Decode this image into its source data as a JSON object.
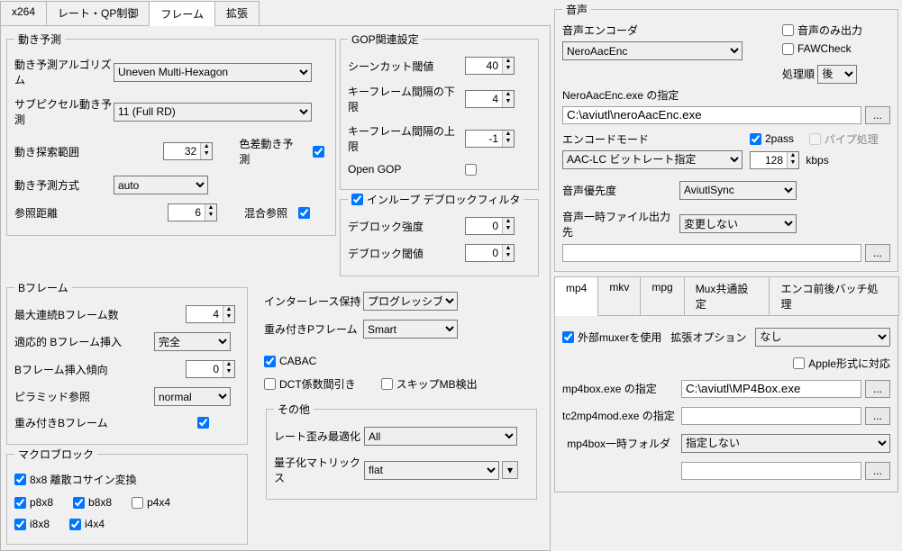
{
  "tabs": [
    "x264",
    "レート・QP制御",
    "フレーム",
    "拡張"
  ],
  "active_tab": "フレーム",
  "motion": {
    "legend": "動き予測",
    "algo_label": "動き予測アルゴリズム",
    "algo_value": "Uneven Multi-Hexagon",
    "subpixel_label": "サブピクセル動き予測",
    "subpixel_value": "11 (Full RD)",
    "range_label": "動き探索範囲",
    "range_value": "32",
    "chroma_label": "色差動き予測",
    "chroma_checked": true,
    "method_label": "動き予測方式",
    "method_value": "auto",
    "refdist_label": "参照距離",
    "refdist_value": "6",
    "mixed_label": "混合参照",
    "mixed_checked": true
  },
  "bframe": {
    "legend": "Bフレーム",
    "max_label": "最大連続Bフレーム数",
    "max_value": "4",
    "adaptive_label": "適応的 Bフレーム挿入",
    "adaptive_value": "完全",
    "bias_label": "Bフレーム挿入傾向",
    "bias_value": "0",
    "pyramid_label": "ピラミッド参照",
    "pyramid_value": "normal",
    "weightb_label": "重み付きBフレーム",
    "weightb_checked": true
  },
  "mb": {
    "legend": "マクロブロック",
    "dct8_label": "8x8 離散コサイン変換",
    "p8x8": "p8x8",
    "b8x8": "b8x8",
    "p4x4": "p4x4",
    "i8x8": "i8x8",
    "i4x4": "i4x4"
  },
  "gop": {
    "legend": "GOP関連設定",
    "scenecut_label": "シーンカット閾値",
    "scenecut_value": "40",
    "minkey_label": "キーフレーム間隔の下限",
    "minkey_value": "4",
    "maxkey_label": "キーフレーム間隔の上限",
    "maxkey_value": "-1",
    "opengop_label": "Open GOP"
  },
  "deblock": {
    "enable_label": "インループ デブロックフィルタ",
    "enable_checked": true,
    "strength_label": "デブロック強度",
    "strength_value": "0",
    "thresh_label": "デブロック閾値",
    "thresh_value": "0"
  },
  "mid": {
    "interlace_label": "インターレース保持",
    "interlace_value": "プログレッシブ",
    "weightp_label": "重み付きPフレーム",
    "weightp_value": "Smart",
    "cabac_label": "CABAC",
    "cabac_checked": true,
    "dct_decimate_label": "DCT係数間引き",
    "skip_mb_label": "スキップMB検出"
  },
  "other": {
    "legend": "その他",
    "trellis_label": "レート歪み最適化",
    "trellis_value": "All",
    "cqm_label": "量子化マトリックス",
    "cqm_value": "flat"
  },
  "audio": {
    "legend": "音声",
    "encoder_label": "音声エンコーダ",
    "encoder_value": "NeroAacEnc",
    "audio_only_label": "音声のみ出力",
    "fawcheck_label": "FAWCheck",
    "proc_order_label": "処理順",
    "proc_order_value": "後",
    "exe_label": "NeroAacEnc.exe の指定",
    "exe_path": "C:\\aviutl\\neroAacEnc.exe",
    "mode_label": "エンコードモード",
    "mode_value": "AAC-LC ビットレート指定",
    "twopass_label": "2pass",
    "pipe_label": "パイプ処理",
    "bitrate_value": "128",
    "bitrate_unit": "kbps",
    "priority_label": "音声優先度",
    "priority_value": "AviutlSync",
    "tmp_label": "音声一時ファイル出力先",
    "tmp_value": "変更しない"
  },
  "mux": {
    "tabs": [
      "mp4",
      "mkv",
      "mpg",
      "Mux共通設定",
      "エンコ前後バッチ処理"
    ],
    "active": "mp4",
    "ext_muxer_label": "外部muxerを使用",
    "ext_muxer_checked": true,
    "ext_opt_label": "拡張オプション",
    "ext_opt_value": "なし",
    "apple_label": "Apple形式に対応",
    "mp4box_label": "mp4box.exe の指定",
    "mp4box_path": "C:\\aviutl\\MP4Box.exe",
    "tc2mp4_label": "tc2mp4mod.exe の指定",
    "tc2mp4_path": "",
    "mp4tmp_label": "mp4box一時フォルダ",
    "mp4tmp_value": "指定しない",
    "mp4tmp_path": ""
  },
  "browse": "..."
}
